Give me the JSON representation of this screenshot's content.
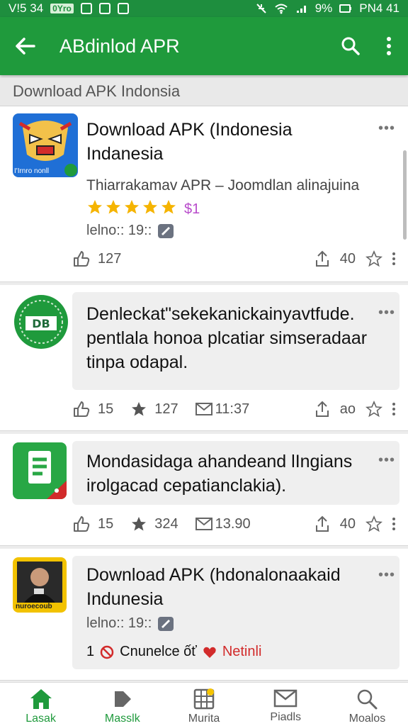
{
  "status": {
    "time": "V!5 34",
    "chip": "0Yro",
    "battery": "9%",
    "carrier": "PN4 41"
  },
  "appbar": {
    "title": "ABdinlod APR"
  },
  "section": {
    "title": "Download APK Indonsia"
  },
  "cards": [
    {
      "title": "Download APK (Indonesia Indanesia",
      "thumb_text": "I'Irnro nonll",
      "subtitle": "Thiarrakamav APR – Joomdlan alinajuina",
      "stars": 5,
      "price": "$1",
      "meta": "lelno:: 19::",
      "likes": "127",
      "shares": "40"
    },
    {
      "title": "Denleckat\"sekekanickainyavtfude. pentlala honoa plcatiar simseradaar tinpa odapal.",
      "thumb_text": "DB",
      "likes": "15",
      "stars": "127",
      "time": "11:37",
      "shares": "ao"
    },
    {
      "title": "Mondasidaga ahandeand lIngians irolgacad cepatianclakia).",
      "likes": "15",
      "stars": "324",
      "time": "13.90",
      "shares": "40"
    },
    {
      "title": "Download APK (hdonalonaakaid Indunesia",
      "thumb_text": "nuroecoub",
      "meta": "lelno:: 19::",
      "badge_num": "1",
      "badge_text": "Cnunelce ốť",
      "badge_link": "Netinli"
    }
  ],
  "bottom_nav": [
    {
      "label": "Lasak",
      "icon": "home-icon"
    },
    {
      "label": "Masslk",
      "icon": "play-icon"
    },
    {
      "label": "Murita",
      "icon": "grid-icon"
    },
    {
      "label": "Piadls",
      "icon": "mail-icon"
    },
    {
      "label": "Moalos",
      "icon": "search-icon"
    }
  ],
  "colors": {
    "primary": "#1f9a3c",
    "star": "#f5b400",
    "accent_red": "#d22b2b"
  }
}
